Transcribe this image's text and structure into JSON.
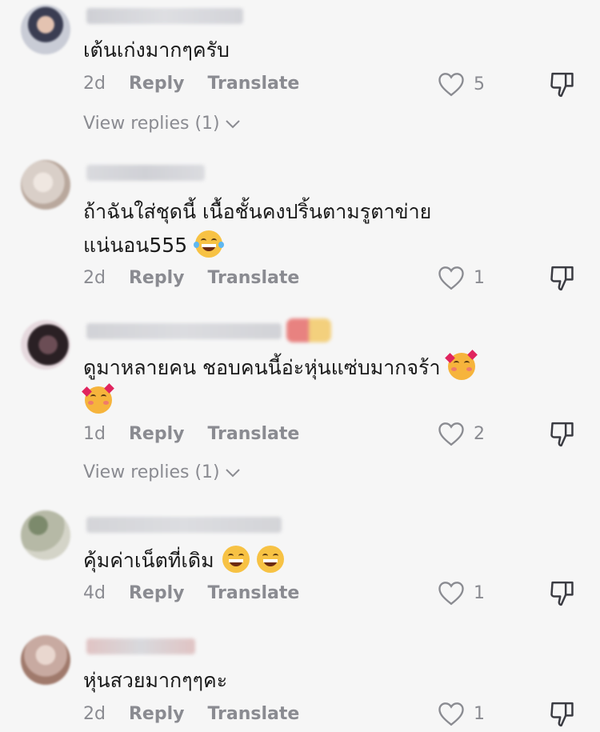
{
  "comments": [
    {
      "text": "เต้นเก่งมากๆครับ",
      "time": "2d",
      "reply_label": "Reply",
      "translate_label": "Translate",
      "likes": "5",
      "view_replies": "View replies (1)",
      "avatar_colors": [
        "#c9ccd6",
        "#3a3d52",
        "#e4c3b1"
      ]
    },
    {
      "text_line1": "ถ้าฉันใส่ชุดนี้ เนื้อชั้นคงปริ้นตามรูตาข่าย",
      "text_line2": "แน่นอน555",
      "time": "2d",
      "reply_label": "Reply",
      "translate_label": "Translate",
      "likes": "1",
      "avatar_colors": [
        "#d9cfc8",
        "#efe7e1",
        "#b9a89d"
      ]
    },
    {
      "text_line1": "ดูมาหลายคน ชอบคนนี้อ่ะหุ่นแซ่บมากจร้า",
      "time": "1d",
      "reply_label": "Reply",
      "translate_label": "Translate",
      "likes": "2",
      "view_replies": "View replies (1)",
      "avatar_colors": [
        "#2a2024",
        "#6b4d55",
        "#e6d9de"
      ]
    },
    {
      "text": "คุ้มค่าเน็ตที่เดิม",
      "time": "4d",
      "reply_label": "Reply",
      "translate_label": "Translate",
      "likes": "1",
      "avatar_colors": [
        "#b6b9a6",
        "#d4d4c8",
        "#7c8a6c"
      ]
    },
    {
      "text": "หุ่นสวยมากๆๆคะ",
      "time": "2d",
      "reply_label": "Reply",
      "translate_label": "Translate",
      "likes": "1",
      "avatar_colors": [
        "#c8aaa1",
        "#e9d7cf",
        "#a07a6c"
      ]
    }
  ],
  "colors": {
    "background": "#f6f6f6",
    "text": "#1a1a1a",
    "meta": "#8a8b91",
    "username_blur": "#b9bac2"
  },
  "icons": {
    "like": "heart-outline-icon",
    "dislike": "thumbs-down-icon",
    "expand": "chevron-down-icon"
  }
}
